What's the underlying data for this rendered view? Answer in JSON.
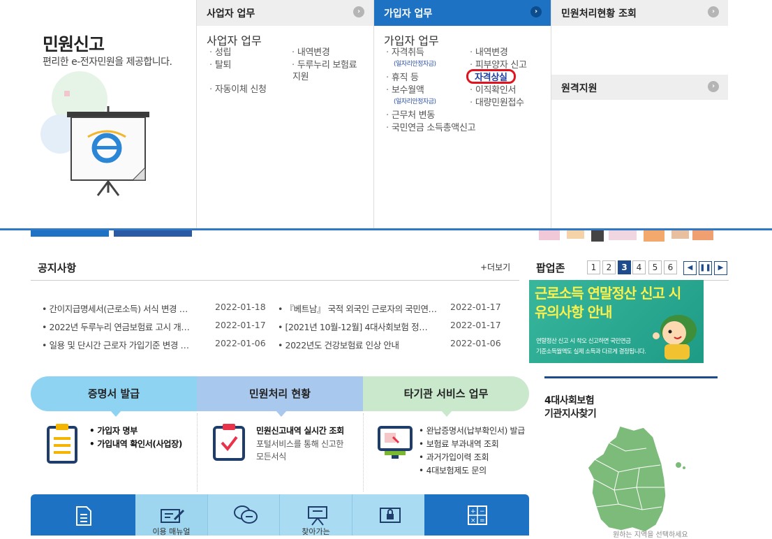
{
  "mega_menu": {
    "intro": {
      "title": "민원신고",
      "subtitle": "편리한 e-전자민원을 제공합니다."
    },
    "business": {
      "header": "사업자 업무",
      "subheader": "사업자 업무",
      "items_left": [
        "성립",
        "탈퇴",
        "자동이체 신청"
      ],
      "items_right": [
        "내역변경",
        "두루누리 보험료",
        "지원"
      ]
    },
    "subscriber": {
      "header": "가입자 업무",
      "subheader": "가입자 업무",
      "items_left": [
        "자격취득",
        "(일자리안정자금)",
        "휴직 등",
        "보수월액",
        "(일자리안정자금)",
        "근무처 변동",
        "국민연금 소득총액신고"
      ],
      "items_right": [
        "내역변경",
        "피부양자 신고",
        "자격상실",
        "이직확인서",
        "대량민원접수"
      ]
    },
    "status": {
      "header": "민원처리현황 조회",
      "remote_header": "원격지원"
    }
  },
  "notice": {
    "title": "공지사항",
    "more": "+더보기",
    "items": [
      {
        "text": "간이지급명세서(근로소득) 서식 변경 …",
        "date": "2022-01-18"
      },
      {
        "text": "2022년 두루누리 연금보험료 고시 개…",
        "date": "2022-01-17"
      },
      {
        "text": "일용 및 단시간 근로자 가입기준 변경 …",
        "date": "2022-01-06"
      },
      {
        "text": "『베트남』 국적 외국인 근로자의 국민연…",
        "date": "2022-01-17"
      },
      {
        "text": "[2021년 10월-12월] 4대사회보험 정…",
        "date": "2022-01-17"
      },
      {
        "text": "2022년도 건강보험료 인상 안내",
        "date": "2022-01-06"
      }
    ]
  },
  "popup": {
    "title": "팝업존",
    "pages": [
      "1",
      "2",
      "3",
      "4",
      "5",
      "6"
    ],
    "current_page": "3",
    "banner_line1": "근로소득 연말정산 신고 시",
    "banner_line2": "유의사항 안내",
    "banner_desc1": "연말정산 신고 시 착오 신고하면 국민연금",
    "banner_desc2": "기준소득월액도 실제 소득과 다르게 결정됩니다."
  },
  "services": {
    "tabs": [
      "증명서 발급",
      "민원처리 현황",
      "타기관 서비스 업무"
    ],
    "cert": [
      "가입자 명부",
      "가입내역 확인서(사업장)"
    ],
    "status": {
      "title": "민원신고내역 실시간 조회",
      "desc1": "포털서비스를 통해 신고한",
      "desc2": "모든서식"
    },
    "other": [
      "완납증명서(납부확인서) 발급",
      "보험료 부과내역 조회",
      "과거가입이력 조회",
      "4대보험제도 문의"
    ]
  },
  "bottom_menu": [
    "이용 매뉴얼",
    "찾아가는"
  ],
  "map": {
    "title_line1": "4대사회보험",
    "title_line2": "기관지사찾기",
    "hint": "원하는 지역을 선택하세요"
  },
  "colors": {
    "active_blue": "#1e72c4",
    "navy": "#1e4b8c",
    "banner_green": "#2aa98f"
  }
}
